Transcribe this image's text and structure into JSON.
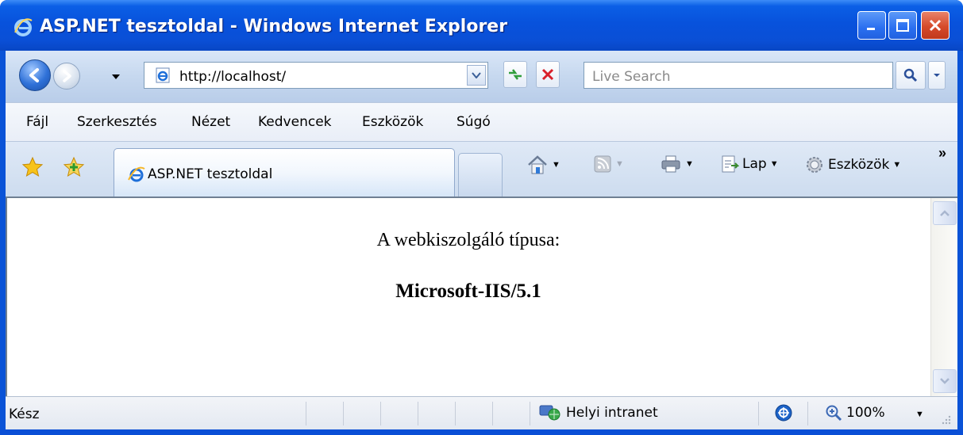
{
  "window": {
    "title": "ASP.NET tesztoldal - Windows Internet Explorer",
    "controls": {
      "minimize": "minimize-icon",
      "maximize": "maximize-icon",
      "close": "close-icon"
    }
  },
  "navbar": {
    "address": "http://localhost/",
    "search_placeholder": "Live Search",
    "icons": [
      "back-arrow-icon",
      "forward-arrow-icon",
      "refresh-icon",
      "stop-icon",
      "search-icon"
    ]
  },
  "menubar": {
    "items": [
      "Fájl",
      "Szerkesztés",
      "Nézet",
      "Kedvencek",
      "Eszközök",
      "Súgó"
    ]
  },
  "tabbar": {
    "active_tab": "ASP.NET tesztoldal",
    "commands": {
      "page": "Lap",
      "tools": "Eszközök"
    },
    "more": "»"
  },
  "page": {
    "label": "A webkiszolgáló típusa:",
    "value": "Microsoft-IIS/5.1"
  },
  "statusbar": {
    "status": "Kész",
    "zone": "Helyi intranet",
    "zoom": "100%"
  },
  "colors": {
    "titlebar": "#0852dc",
    "toolbar": "#c6d8ef",
    "close_button": "#d64a2a"
  }
}
